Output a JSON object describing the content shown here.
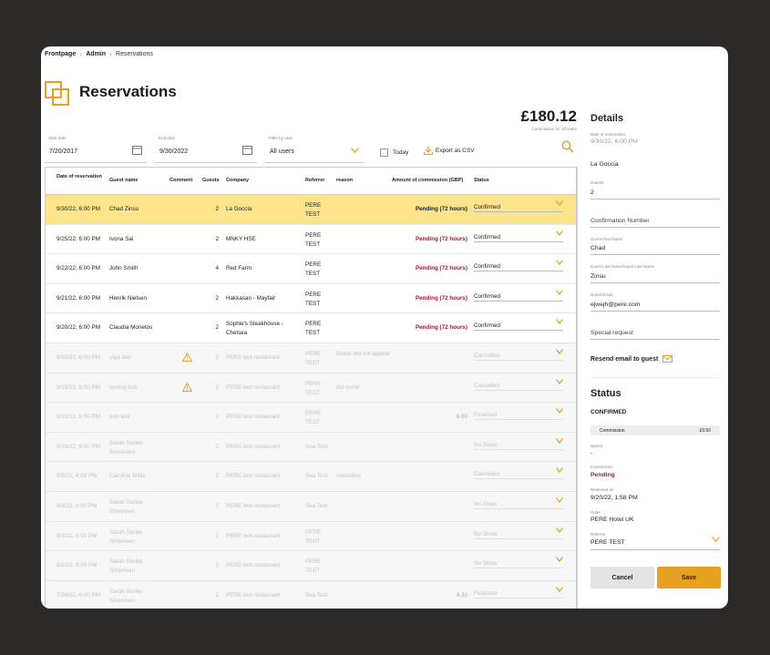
{
  "breadcrumb": {
    "items": [
      "Frontpage",
      "Admin",
      "Reservations"
    ]
  },
  "page": {
    "title": "Reservations"
  },
  "summary": {
    "amount": "£180.12",
    "caption": "Commission for All users"
  },
  "filters": {
    "start_label": "Start date",
    "start_value": "7/20/2017",
    "end_label": "End date",
    "end_value": "9/30/2022",
    "user_label": "Filter by user",
    "user_value": "All users",
    "today_label": "Today",
    "export_label": "Export as CSV"
  },
  "table": {
    "headers": {
      "date": "Date of reservation",
      "name": "Guest name",
      "comment": "Comment",
      "guests": "Guests",
      "company": "Company",
      "referrer": "Referrer",
      "reason": "reason",
      "commission": "Amount of commission (GBP)",
      "status": "Status"
    },
    "rows": [
      {
        "date": "9/30/22, 6:00 PM",
        "name": "Chad Zinsu",
        "warn": false,
        "guests": "2",
        "company": "La Goccia",
        "referrer": "PERE TEST",
        "reason": "",
        "commission": "Pending (72 hours)",
        "status": "Confirmed",
        "state": "sel"
      },
      {
        "date": "9/25/22, 6:00 PM",
        "name": "Ivona Sal",
        "warn": false,
        "guests": "2",
        "company": "MNKY HSE",
        "referrer": "PERE TEST",
        "reason": "",
        "commission": "Pending (72 hours)",
        "status": "Confirmed",
        "state": "act"
      },
      {
        "date": "9/22/22, 6:00 PM",
        "name": "John Smith",
        "warn": false,
        "guests": "4",
        "company": "Red Farm",
        "referrer": "PERE TEST",
        "reason": "",
        "commission": "Pending (72 hours)",
        "status": "Confirmed",
        "state": "act"
      },
      {
        "date": "9/21/22, 6:00 PM",
        "name": "Henrik Nielsen",
        "warn": false,
        "guests": "2",
        "company": "Hakkasan - Mayfair",
        "referrer": "PERE TEST",
        "reason": "",
        "commission": "Pending (72 hours)",
        "status": "Confirmed",
        "state": "act"
      },
      {
        "date": "9/20/22, 6:00 PM",
        "name": "Claudia Monetos",
        "warn": false,
        "guests": "2",
        "company": "Sophie's Steakhouse - Chelsea",
        "referrer": "PERE TEST",
        "reason": "",
        "commission": "Pending (72 hours)",
        "status": "Confirmed",
        "state": "act"
      },
      {
        "date": "9/15/22, 6:00 PM",
        "name": "uiga test",
        "warn": true,
        "guests": "2",
        "company": "PERE test restaurant",
        "referrer": "PERE TEST",
        "reason": "Guest did not appear",
        "commission": "",
        "status": "Cancelled",
        "state": "dim"
      },
      {
        "date": "9/15/22, 6:00 PM",
        "name": "testing test",
        "warn": true,
        "guests": "2",
        "company": "PERE test restaurant",
        "referrer": "PERE TEST",
        "reason": "did come",
        "commission": "",
        "status": "Cancelled",
        "state": "dim"
      },
      {
        "date": "8/23/22, 6:00 PM",
        "name": "tom test",
        "warn": false,
        "guests": "2",
        "company": "PERE test restaurant",
        "referrer": "PERE TEST",
        "reason": "",
        "commission": "6.00",
        "status": "Finalized",
        "state": "dim"
      },
      {
        "date": "8/16/22, 6:00 PM",
        "name": "Sarah Sunke Simonsen",
        "warn": false,
        "guests": "2",
        "company": "PERE test restaurant",
        "referrer": "Sea Test",
        "reason": "",
        "commission": "",
        "status": "No Show",
        "state": "dim"
      },
      {
        "date": "8/8/22, 6:00 PM",
        "name": "Caroline Miller",
        "warn": false,
        "guests": "2",
        "company": "PERE test restaurant",
        "referrer": "Sea Test",
        "reason": "cancelled",
        "commission": "",
        "status": "Cancelled",
        "state": "dim"
      },
      {
        "date": "8/8/22, 6:00 PM",
        "name": "Sarah Sunke Simonsen",
        "warn": false,
        "guests": "2",
        "company": "PERE test restaurant",
        "referrer": "Sea Test",
        "reason": "",
        "commission": "",
        "status": "No Show",
        "state": "dim"
      },
      {
        "date": "8/3/22, 6:00 PM",
        "name": "Sarah Sunke Simonsen",
        "warn": false,
        "guests": "2",
        "company": "PERE test restaurant",
        "referrer": "PERE TEST",
        "reason": "",
        "commission": "",
        "status": "No Show",
        "state": "dim"
      },
      {
        "date": "8/2/22, 6:00 PM",
        "name": "Sarah Sunke Simonsen",
        "warn": false,
        "guests": "2",
        "company": "PERE test restaurant",
        "referrer": "PERE TEST",
        "reason": "",
        "commission": "",
        "status": "No Show",
        "state": "dim"
      },
      {
        "date": "7/26/22, 6:00 PM",
        "name": "Sarah Sunke Simonsen",
        "warn": false,
        "guests": "2",
        "company": "PERE test restaurant",
        "referrer": "Sea Test",
        "reason": "",
        "commission": "4.32",
        "status": "Finalized",
        "state": "dim"
      }
    ]
  },
  "details": {
    "title": "Details",
    "date_label": "Date of reservation",
    "date_value": "9/30/22, 6:00 PM",
    "venue": "La Goccia",
    "guests_label": "Guests",
    "guests_value": "2",
    "confirmation_placeholder": "Confirmation Number",
    "first_name_label": "Guest First Name",
    "first_name_value": "Chad",
    "last_name_label": "Guest Last NameGuest Last Name",
    "last_name_value": "Zinsu",
    "email_label": "Guest Email",
    "email_value": "ejwejh@pere.com",
    "special_placeholder": "Special request",
    "resend_label": "Resend email to guest"
  },
  "status_panel": {
    "title": "Status",
    "state": "CONFIRMED",
    "commission_bar_label": "Commission",
    "commission_bar_value": "£9.50",
    "spend_label": "Spend",
    "spend_value": "-",
    "commission_label": "Commission",
    "commission_value": "Pending",
    "reserved_label": "Reserved on",
    "reserved_value": "9/20/22, 1:58 PM",
    "hotel_label": "Hotel",
    "hotel_value": "PERE Hotel UK",
    "referrer_label": "Referrer",
    "referrer_value": "PERE TEST"
  },
  "buttons": {
    "cancel": "Cancel",
    "save": "Save"
  },
  "colors": {
    "accent": "#e8a020",
    "pending": "#9b1b30",
    "selected_row": "#fde38a"
  }
}
